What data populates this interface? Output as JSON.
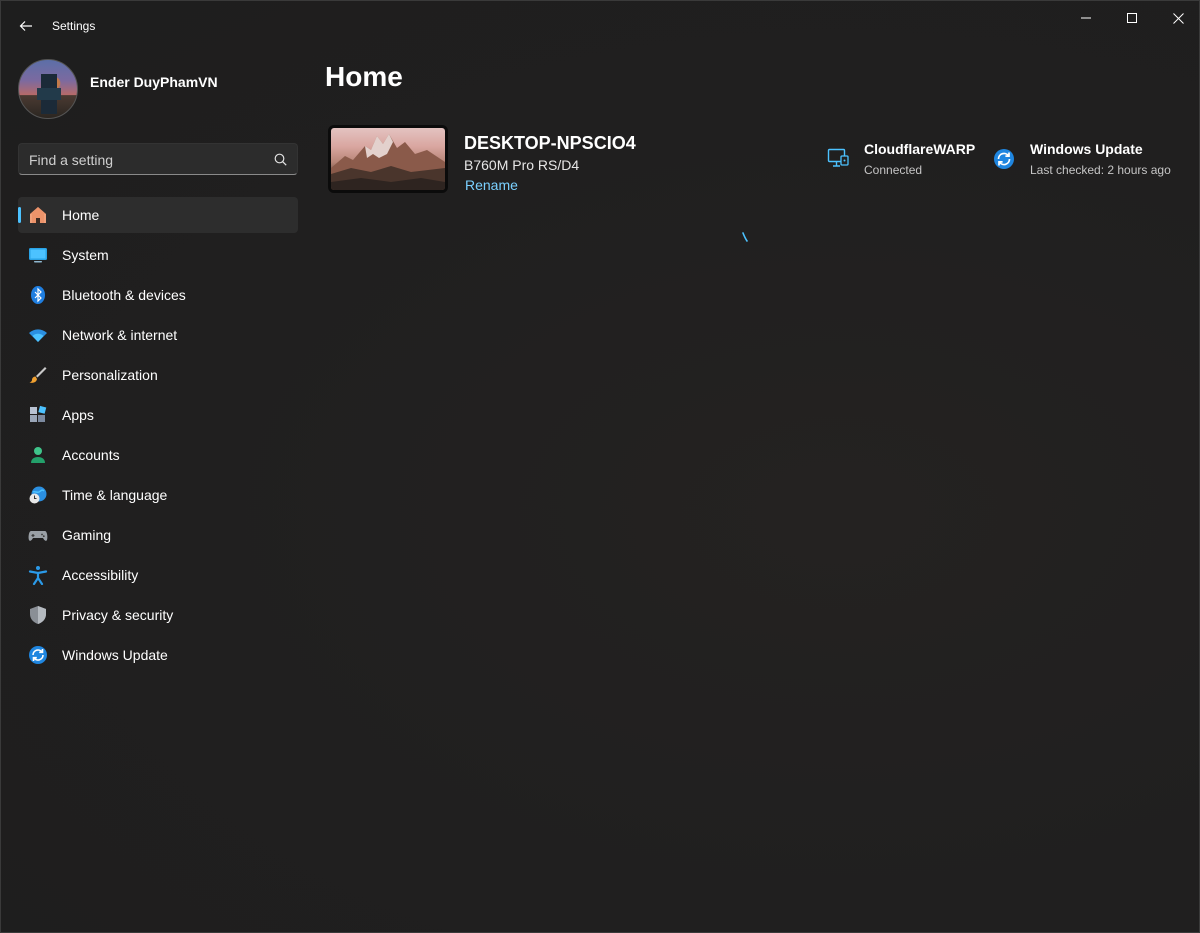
{
  "window": {
    "title": "Settings",
    "controls": {
      "minimize": "minimize",
      "maximize": "maximize",
      "close": "close"
    }
  },
  "profile": {
    "name": "Ender DuyPhamVN"
  },
  "search": {
    "placeholder": "Find a setting",
    "value": ""
  },
  "nav": {
    "items": [
      {
        "label": "Home",
        "icon": "home-icon",
        "active": true
      },
      {
        "label": "System",
        "icon": "system-icon"
      },
      {
        "label": "Bluetooth & devices",
        "icon": "bluetooth-icon"
      },
      {
        "label": "Network & internet",
        "icon": "wifi-icon"
      },
      {
        "label": "Personalization",
        "icon": "brush-icon"
      },
      {
        "label": "Apps",
        "icon": "apps-icon"
      },
      {
        "label": "Accounts",
        "icon": "account-icon"
      },
      {
        "label": "Time & language",
        "icon": "globe-clock-icon"
      },
      {
        "label": "Gaming",
        "icon": "gamepad-icon"
      },
      {
        "label": "Accessibility",
        "icon": "accessibility-icon"
      },
      {
        "label": "Privacy & security",
        "icon": "shield-icon"
      },
      {
        "label": "Windows Update",
        "icon": "update-icon"
      }
    ]
  },
  "main": {
    "title": "Home",
    "device": {
      "name": "DESKTOP-NPSCIO4",
      "model": "B760M Pro RS/D4",
      "rename_label": "Rename"
    },
    "cards": {
      "warp": {
        "title": "CloudflareWARP",
        "status": "Connected",
        "icon": "vpn-monitor-icon"
      },
      "update": {
        "title": "Windows Update",
        "status": "Last checked: 2 hours ago",
        "icon": "update-icon"
      }
    }
  },
  "colors": {
    "background": "#202020",
    "accent": "#4cc2ff",
    "link": "#7ad0ff",
    "nav_active": "#2d2d2d"
  }
}
